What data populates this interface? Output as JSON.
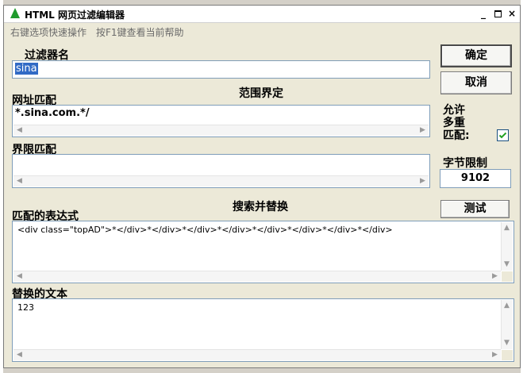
{
  "window": {
    "title": "HTML 网页过滤编辑器",
    "controls": {
      "minimize": "_",
      "close": "×"
    }
  },
  "hints": {
    "right_click": "右键选项快速操作",
    "f1_help": "按F1键查看当前帮助"
  },
  "filter_name": {
    "label": "过滤器名",
    "value": "sina"
  },
  "scope": {
    "heading": "范围界定",
    "url_match_label": "网址匹配",
    "url_match_value": "*.sina.com.*/",
    "boundary_match_label": "界限匹配",
    "boundary_match_value": ""
  },
  "search_replace": {
    "heading": "搜索并替换",
    "pattern_label": "匹配的表达式",
    "pattern_value": "<div class=\"topAD\">*</div>*</div>*</div>*</div>*</div>*</div>*</div>*</div>",
    "replacement_label": "替换的文本",
    "replacement_value": "123"
  },
  "buttons": {
    "ok": "确定",
    "cancel": "取消",
    "test": "测试"
  },
  "options": {
    "allow_multiple_label_line1": "允许",
    "allow_multiple_label_line2": "多重",
    "allow_multiple_label_line3": "匹配:",
    "allow_multiple_checked": true,
    "byte_limit_label": "字节限制",
    "byte_limit_value": "9102"
  },
  "icons": {
    "app": "green-triangle-icon",
    "checkbox_mark": "checkmark-icon"
  },
  "colors": {
    "window_bg": "#ece9d8",
    "field_border": "#7f9db9",
    "selection": "#316ac5",
    "app_icon": "#1f9a2c"
  }
}
